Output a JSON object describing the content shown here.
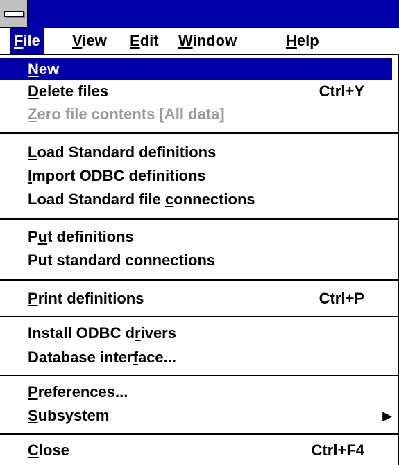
{
  "colors": {
    "titlebar": "#0000a8",
    "highlight": "#0000a8",
    "disabled": "#9a9a9a"
  },
  "system_menu_icon": "minus-bar-icon",
  "menubar": {
    "items": [
      {
        "mnemonic": "F",
        "rest": "ile"
      },
      {
        "mnemonic": "V",
        "rest": "iew"
      },
      {
        "mnemonic": "E",
        "rest": "dit"
      },
      {
        "mnemonic": "W",
        "rest": "indow"
      },
      {
        "mnemonic": "H",
        "rest": "elp"
      }
    ]
  },
  "menu": {
    "new": {
      "pre": "",
      "mn": "N",
      "post": "ew"
    },
    "delete_files": {
      "pre": "",
      "mn": "D",
      "post": "elete files",
      "shortcut": "Ctrl+Y"
    },
    "zero_file": {
      "pre": "",
      "mn": "Z",
      "post": "ero file contents [All data]"
    },
    "load_std_defs": {
      "pre": "",
      "mn": "L",
      "post": "oad Standard definitions"
    },
    "import_odbc": {
      "pre": "",
      "mn": "I",
      "post": "mport ODBC definitions"
    },
    "load_std_conn": {
      "pre": "Load Standard file ",
      "mn": "c",
      "post": "onnections"
    },
    "put_defs": {
      "pre": "P",
      "mn": "u",
      "post": "t definitions"
    },
    "put_std_conn": {
      "pre": "Put standard connections",
      "mn": "",
      "post": ""
    },
    "print_defs": {
      "pre": "",
      "mn": "P",
      "post": "rint definitions",
      "shortcut": "Ctrl+P"
    },
    "install_odbc": {
      "pre": "Install ODBC d",
      "mn": "r",
      "post": "ivers"
    },
    "db_interface": {
      "pre": "Database inter",
      "mn": "f",
      "post": "ace..."
    },
    "preferences": {
      "pre": "",
      "mn": "P",
      "post": "references..."
    },
    "subsystem": {
      "pre": "",
      "mn": "S",
      "post": "ubsystem",
      "arrow": "▶"
    },
    "close": {
      "pre": "",
      "mn": "C",
      "post": "lose",
      "shortcut": "Ctrl+F4"
    }
  }
}
